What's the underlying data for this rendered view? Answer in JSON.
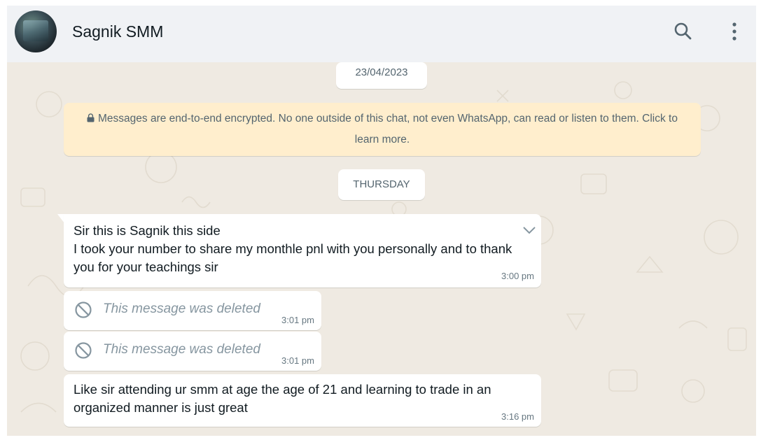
{
  "header": {
    "contact_name": "Sagnik SMM",
    "icons": [
      "search-icon",
      "menu-icon"
    ]
  },
  "chat": {
    "date_labels": [
      "23/04/2023",
      "THURSDAY"
    ],
    "encryption_notice": "Messages are end-to-end encrypted. No one outside of this chat, not even WhatsApp, can read or listen to them. Click to learn more.",
    "messages": [
      {
        "text": "Sir this is Sagnik this side\nI took your number to share my monthle pnl with you personally and to thank you for your teachings sir",
        "time": "3:00 pm"
      },
      {
        "text": "This message was deleted",
        "time": "3:01 pm",
        "deleted": true
      },
      {
        "text": "This message was deleted",
        "time": "3:01 pm",
        "deleted": true
      },
      {
        "text": "Like sir attending ur smm at age the age of 21 and learning to trade in an organized manner is just great",
        "time": "3:16 pm"
      }
    ]
  },
  "colors": {
    "header_bg": "#f0f2f5",
    "chat_bg": "#efeae2",
    "bubble_bg": "#ffffff",
    "banner_bg": "#ffeecd",
    "text_primary": "#111b21",
    "text_secondary": "#667781"
  }
}
